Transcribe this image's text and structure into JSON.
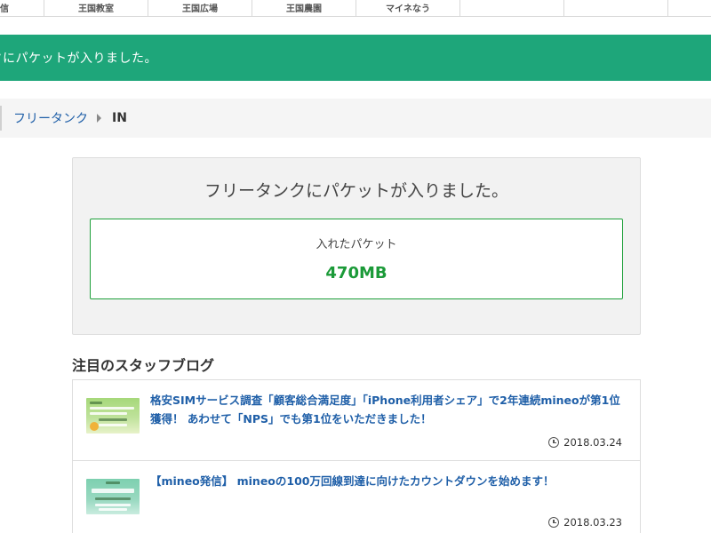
{
  "nav": {
    "items": [
      "信",
      "王国教室",
      "王国広場",
      "王国農園",
      "マイネなう",
      "",
      ""
    ]
  },
  "banner": {
    "text": "ンクにパケットが入りました。"
  },
  "breadcrumb": {
    "link": "フリータンク",
    "current": "IN"
  },
  "result": {
    "title": "フリータンクにパケットが入りました。",
    "amount_label": "入れたパケット",
    "amount_value": "470MB"
  },
  "staff_blog": {
    "heading": "注目のスタッフブログ",
    "posts": [
      {
        "title": "格安SIMサービス調査「顧客総合満足度」「iPhone利用者シェア」で2年連続mineoが第1位獲得！ あわせて「NPS」でも第1位をいただきました！",
        "date": "2018.03.24"
      },
      {
        "title": "【mineo発信】 mineoの100万回線到達に向けたカウントダウンを始めます！",
        "date": "2018.03.23"
      }
    ]
  },
  "colors": {
    "brand_green": "#1ea67a",
    "amount_green": "#1b9a38",
    "link_blue": "#1f5fa8"
  }
}
